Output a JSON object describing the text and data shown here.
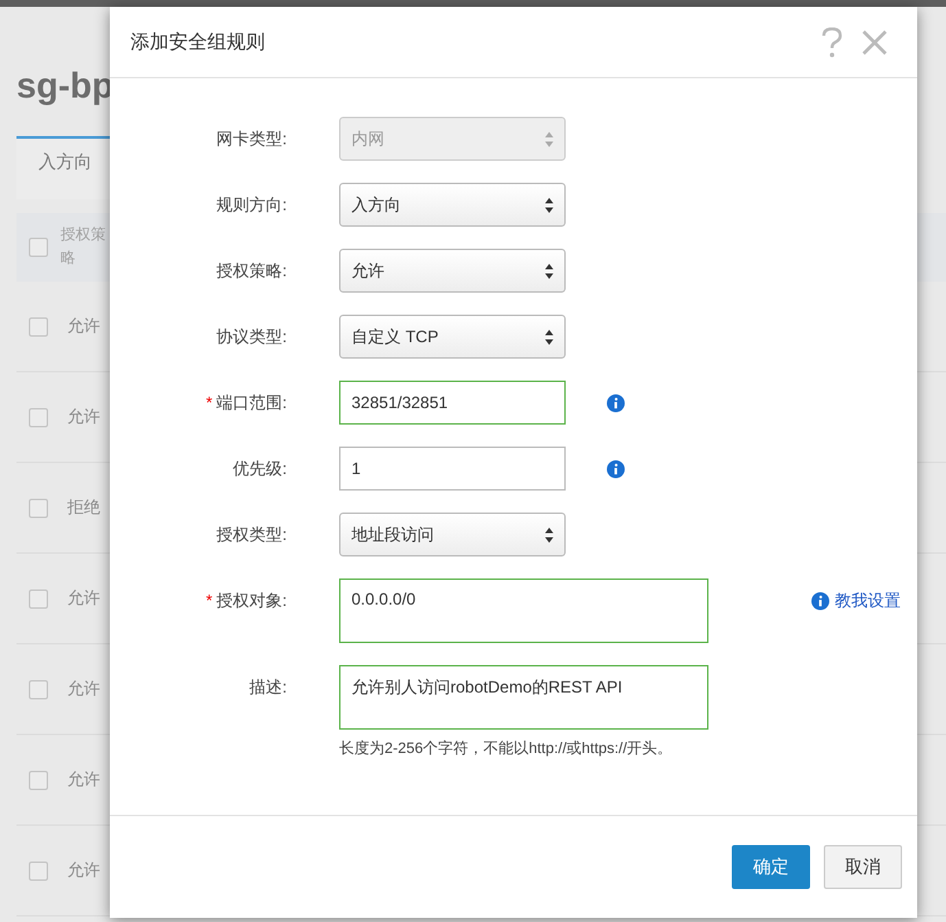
{
  "page": {
    "title": "sg-bp",
    "tab": "入方向",
    "table": {
      "header": "授权策略",
      "header_checked": false,
      "rows": [
        {
          "checked": false,
          "policy": "允许"
        },
        {
          "checked": false,
          "policy": "允许"
        },
        {
          "checked": false,
          "policy": "拒绝"
        },
        {
          "checked": false,
          "policy": "允许"
        },
        {
          "checked": false,
          "policy": "允许"
        },
        {
          "checked": false,
          "policy": "允许"
        },
        {
          "checked": false,
          "policy": "允许"
        }
      ]
    }
  },
  "dialog": {
    "title": "添加安全组规则",
    "fields": [
      {
        "label": "网卡类型:",
        "kind": "select",
        "value": "内网",
        "disabled": true,
        "valid": false,
        "info": false
      },
      {
        "label": "规则方向:",
        "kind": "select",
        "value": "入方向",
        "disabled": false,
        "valid": false,
        "info": false
      },
      {
        "label": "授权策略:",
        "kind": "select",
        "value": "允许",
        "disabled": false,
        "valid": false,
        "info": false
      },
      {
        "label": "协议类型:",
        "kind": "select",
        "value": "自定义 TCP",
        "disabled": false,
        "valid": false,
        "info": false
      },
      {
        "label": "端口范围:",
        "required_mark": "*",
        "kind": "input",
        "value": "32851/32851",
        "disabled": false,
        "valid": true,
        "info": true
      },
      {
        "label": "优先级:",
        "kind": "input",
        "value": "1",
        "disabled": false,
        "valid": false,
        "info": true
      },
      {
        "label": "授权类型:",
        "kind": "select",
        "value": "地址段访问",
        "disabled": false,
        "valid": false,
        "info": false
      },
      {
        "label": "授权对象:",
        "required_mark": "*",
        "kind": "textarea",
        "value": "0.0.0.0/0",
        "disabled": false,
        "valid": true,
        "info": false,
        "help_link": "教我设置"
      },
      {
        "label": "描述:",
        "kind": "textarea",
        "value": "允许别人访问robotDemo的REST API",
        "disabled": false,
        "valid": true,
        "info": false,
        "hint": "长度为2-256个字符，不能以http://或https://开头。"
      }
    ],
    "buttons": [
      {
        "label": "确定",
        "kind": "primary"
      },
      {
        "label": "取消",
        "kind": "secondary"
      }
    ]
  }
}
